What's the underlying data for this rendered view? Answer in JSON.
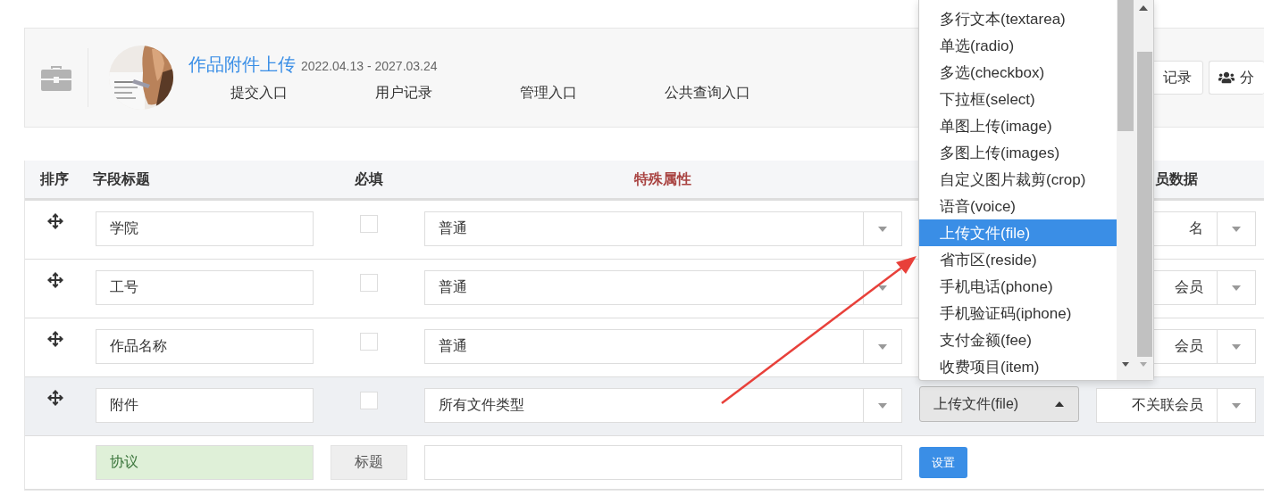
{
  "header": {
    "title": "作品附件上传",
    "dates": "2022.04.13 - 2027.03.24",
    "nav": [
      "提交入口",
      "用户记录",
      "管理入口",
      "公共查询入口"
    ],
    "buttons": [
      {
        "label": "记录",
        "kind": "plain"
      },
      {
        "label": "分",
        "kind": "users"
      }
    ]
  },
  "table": {
    "columns": [
      {
        "kind": "sort",
        "label": "排序"
      },
      {
        "kind": "title",
        "label": "字段标题"
      },
      {
        "kind": "required",
        "label": "必填"
      },
      {
        "kind": "special",
        "label": "特殊属性"
      },
      {
        "kind": "member",
        "label": "员数据"
      }
    ],
    "rows": [
      {
        "title": "学院",
        "required": false,
        "special": "普通",
        "member": "名",
        "selected": false
      },
      {
        "title": "工号",
        "required": false,
        "special": "普通",
        "member": "会员",
        "selected": false
      },
      {
        "title": "作品名称",
        "required": false,
        "special": "普通",
        "member": "会员",
        "selected": false
      },
      {
        "title": "附件",
        "required": false,
        "special": "所有文件类型",
        "type": {
          "value": "上传文件(file)",
          "open": true
        },
        "member": "不关联会员",
        "selected": true
      }
    ],
    "footer": {
      "title": "协议",
      "label": "标题",
      "action": "设置"
    }
  },
  "dropdown": {
    "options": [
      {
        "label": "多行文本(textarea)",
        "selected": false
      },
      {
        "label": "单选(radio)",
        "selected": false
      },
      {
        "label": "多选(checkbox)",
        "selected": false
      },
      {
        "label": "下拉框(select)",
        "selected": false
      },
      {
        "label": "单图上传(image)",
        "selected": false
      },
      {
        "label": "多图上传(images)",
        "selected": false
      },
      {
        "label": "自定义图片裁剪(crop)",
        "selected": false
      },
      {
        "label": "语音(voice)",
        "selected": false
      },
      {
        "label": "上传文件(file)",
        "selected": true
      },
      {
        "label": "省市区(reside)",
        "selected": false
      },
      {
        "label": "手机电话(phone)",
        "selected": false
      },
      {
        "label": "手机验证码(iphone)",
        "selected": false
      },
      {
        "label": "支付金额(fee)",
        "selected": false
      },
      {
        "label": "收费项目(item)",
        "selected": false
      }
    ]
  }
}
